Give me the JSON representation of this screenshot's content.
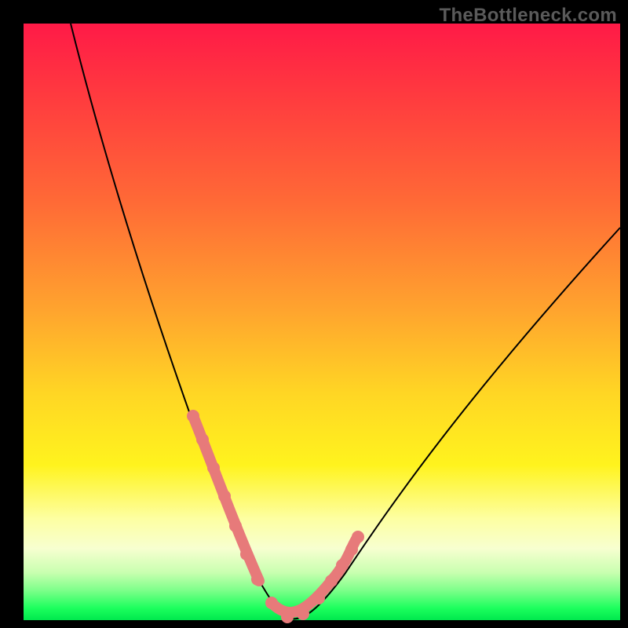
{
  "watermark": "TheBottleneck.com",
  "colors": {
    "frame_border": "#000000",
    "curve": "#000000",
    "beads": "#e77a7a",
    "gradient_stops": [
      "#ff1a47",
      "#ff3a3f",
      "#ff6a36",
      "#ffa42e",
      "#ffd624",
      "#fff31e",
      "#fdffa2",
      "#f7ffd0",
      "#c9ffb0",
      "#7dff8a",
      "#1cff5d",
      "#00e84e"
    ]
  },
  "chart_data": {
    "type": "line",
    "title": "",
    "xlabel": "",
    "ylabel": "",
    "xlim": [
      0,
      100
    ],
    "ylim": [
      0,
      100
    ],
    "grid": false,
    "legend": false,
    "series": [
      {
        "name": "left-branch",
        "x": [
          8,
          12,
          16,
          20,
          24,
          27,
          29,
          31,
          33,
          35,
          37,
          39,
          41,
          43
        ],
        "y": [
          100,
          88,
          76,
          63,
          50,
          40,
          32,
          25,
          19,
          13,
          9,
          5,
          2,
          0
        ]
      },
      {
        "name": "right-branch",
        "x": [
          43,
          46,
          50,
          55,
          60,
          66,
          72,
          78,
          85,
          92,
          100
        ],
        "y": [
          0,
          2,
          5,
          9,
          15,
          22,
          30,
          38,
          47,
          56,
          65
        ]
      }
    ],
    "beaded_segments_x_ranges": {
      "left": [
        27,
        40
      ],
      "right": [
        41,
        54
      ]
    },
    "bead_points": [
      {
        "x": 27.5,
        "y": 38
      },
      {
        "x": 29.5,
        "y": 31
      },
      {
        "x": 31.5,
        "y": 24
      },
      {
        "x": 33.0,
        "y": 19
      },
      {
        "x": 34.5,
        "y": 14
      },
      {
        "x": 36.5,
        "y": 9
      },
      {
        "x": 38.0,
        "y": 5
      },
      {
        "x": 39.5,
        "y": 3
      },
      {
        "x": 41.5,
        "y": 1
      },
      {
        "x": 43.5,
        "y": 0
      },
      {
        "x": 46.0,
        "y": 1.5
      },
      {
        "x": 48.0,
        "y": 3.5
      },
      {
        "x": 50.0,
        "y": 5.5
      },
      {
        "x": 52.0,
        "y": 8
      },
      {
        "x": 54.0,
        "y": 10.5
      }
    ]
  }
}
